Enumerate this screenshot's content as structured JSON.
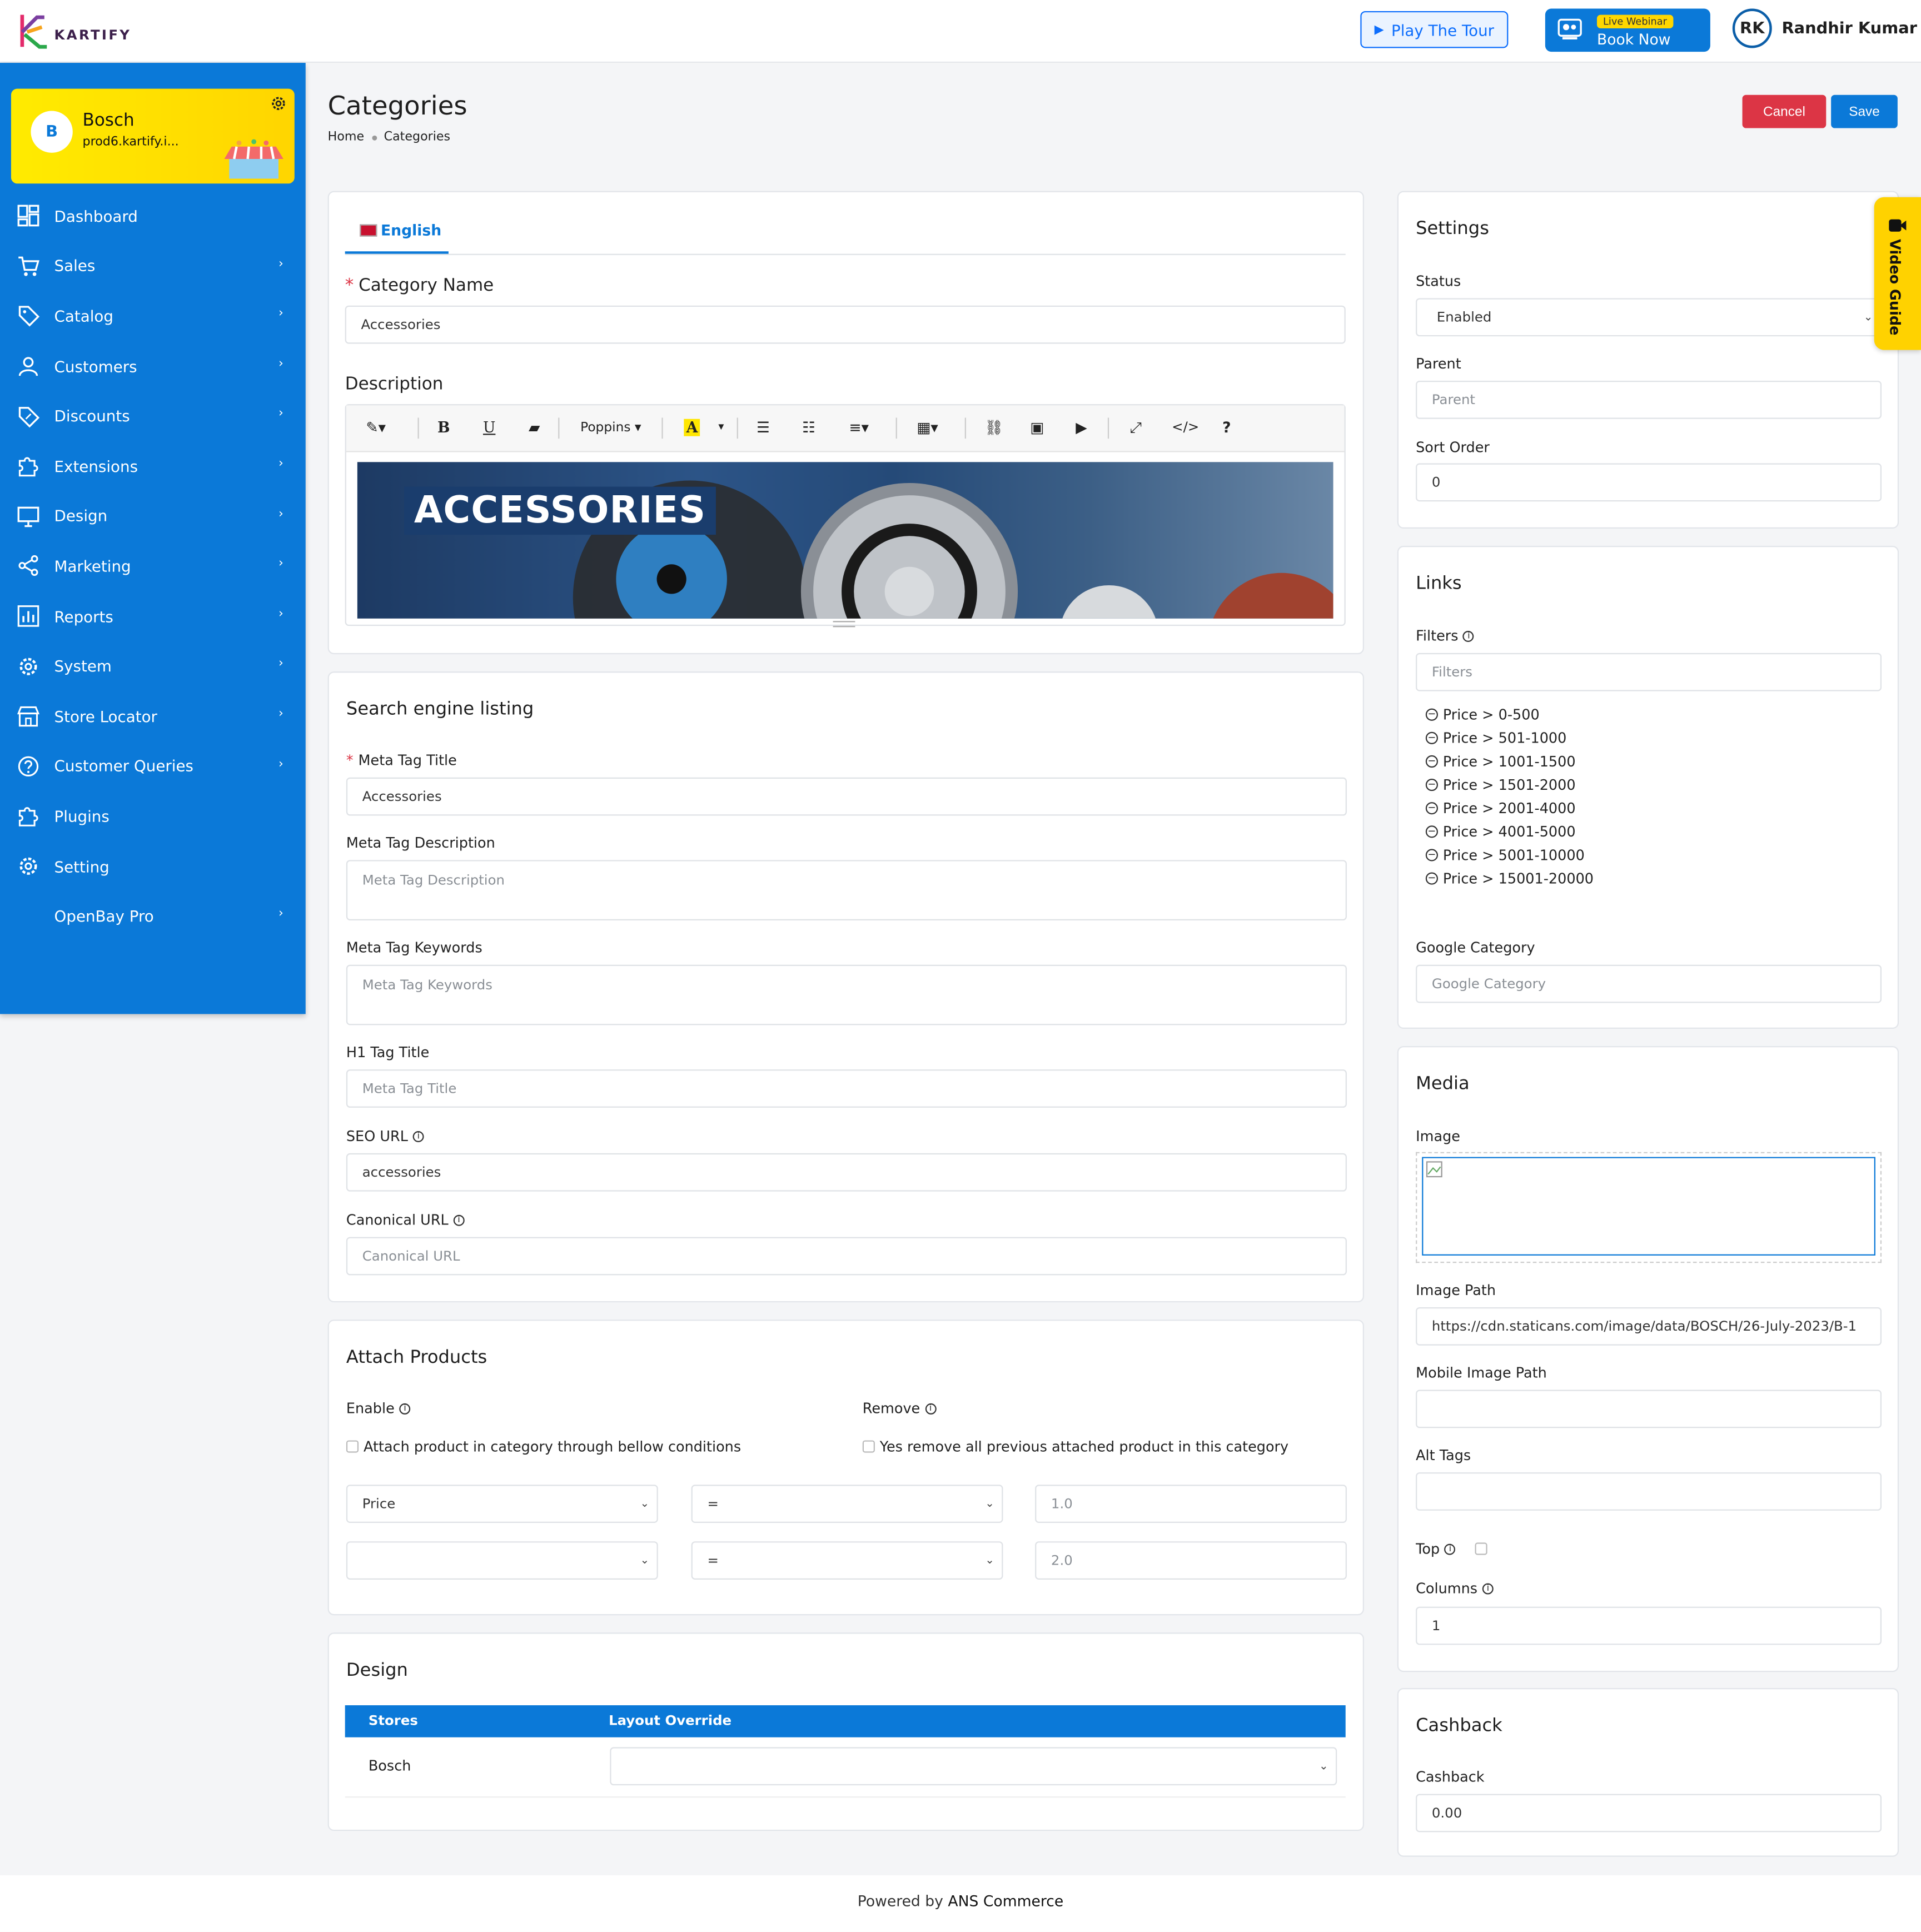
{
  "brand": {
    "name": "KARTIFY"
  },
  "topbar": {
    "tour_label": "Play The Tour",
    "webinar_badge": "Live Webinar",
    "webinar_label": "Book Now",
    "user_initials": "RK",
    "user_name": "Randhir Kumar"
  },
  "store": {
    "initial": "B",
    "name": "Bosch",
    "domain": "prod6.kartify.i..."
  },
  "sidebar": {
    "items": [
      {
        "label": "Dashboard",
        "icon": "dashboard-icon",
        "chevron": false
      },
      {
        "label": "Sales",
        "icon": "cart-icon",
        "chevron": true
      },
      {
        "label": "Catalog",
        "icon": "tag-icon",
        "chevron": true
      },
      {
        "label": "Customers",
        "icon": "user-icon",
        "chevron": true
      },
      {
        "label": "Discounts",
        "icon": "discount-icon",
        "chevron": true
      },
      {
        "label": "Extensions",
        "icon": "puzzle-icon",
        "chevron": true
      },
      {
        "label": "Design",
        "icon": "monitor-icon",
        "chevron": true
      },
      {
        "label": "Marketing",
        "icon": "share-icon",
        "chevron": true
      },
      {
        "label": "Reports",
        "icon": "bar-chart-icon",
        "chevron": true
      },
      {
        "label": "System",
        "icon": "gear-icon",
        "chevron": true
      },
      {
        "label": "Store Locator",
        "icon": "store-icon",
        "chevron": true
      },
      {
        "label": "Customer Queries",
        "icon": "question-icon",
        "chevron": true
      },
      {
        "label": "Plugins",
        "icon": "puzzle-icon",
        "chevron": false
      },
      {
        "label": "Setting",
        "icon": "gear-icon",
        "chevron": false
      },
      {
        "label": "OpenBay Pro",
        "icon": "",
        "chevron": true
      }
    ]
  },
  "page": {
    "title": "Categories",
    "breadcrumb": [
      "Home",
      "Categories"
    ],
    "cancel_label": "Cancel",
    "save_label": "Save"
  },
  "general": {
    "tab_label": "English",
    "category_name_label": "Category Name",
    "category_name_value": "Accessories",
    "description_label": "Description",
    "font_name": "Poppins",
    "banner_text": "ACCESSORIES"
  },
  "seo": {
    "title": "Search engine listing",
    "meta_title_label": "Meta Tag Title",
    "meta_title_value": "Accessories",
    "meta_desc_label": "Meta Tag Description",
    "meta_desc_placeholder": "Meta Tag Description",
    "meta_keywords_label": "Meta Tag Keywords",
    "meta_keywords_placeholder": "Meta Tag Keywords",
    "h1_label": "H1 Tag Title",
    "h1_placeholder": "Meta Tag Title",
    "seo_url_label": "SEO URL",
    "seo_url_value": "accessories",
    "canonical_label": "Canonical URL",
    "canonical_placeholder": "Canonical URL"
  },
  "attach": {
    "title": "Attach Products",
    "enable_label": "Enable",
    "enable_text": "Attach product in category through bellow conditions",
    "remove_label": "Remove",
    "remove_text": "Yes remove all previous attached product in this category",
    "rows": [
      {
        "field": "Price",
        "op": "=",
        "value_placeholder": "1.0"
      },
      {
        "field": "",
        "op": "=",
        "value_placeholder": "2.0"
      }
    ]
  },
  "design": {
    "title": "Design",
    "col_stores": "Stores",
    "col_layout": "Layout Override",
    "store_name": "Bosch"
  },
  "settings": {
    "title": "Settings",
    "status_label": "Status",
    "status_value": "Enabled",
    "parent_label": "Parent",
    "parent_placeholder": "Parent",
    "sort_label": "Sort Order",
    "sort_value": "0"
  },
  "links": {
    "title": "Links",
    "filters_label": "Filters",
    "filters_placeholder": "Filters",
    "filters": [
      "Price > 0-500",
      "Price > 501-1000",
      "Price > 1001-1500",
      "Price > 1501-2000",
      "Price > 2001-4000",
      "Price > 4001-5000",
      "Price > 5001-10000",
      "Price > 15001-20000"
    ],
    "google_label": "Google Category",
    "google_placeholder": "Google Category"
  },
  "media": {
    "title": "Media",
    "image_label": "Image",
    "image_path_label": "Image Path",
    "image_path_value": "https://cdn.staticans.com/image/data/BOSCH/26-July-2023/B-1",
    "mobile_path_label": "Mobile Image Path",
    "alt_label": "Alt Tags",
    "top_label": "Top",
    "columns_label": "Columns",
    "columns_value": "1"
  },
  "cashback": {
    "title": "Cashback",
    "label": "Cashback",
    "value": "0.00"
  },
  "video_guide": "Video Guide",
  "footer": {
    "prefix": "Powered by",
    "brand": "ANS Commerce"
  },
  "colors": {
    "primary": "#0b79d8",
    "danger": "#dc3545",
    "accent": "#ffd200"
  }
}
